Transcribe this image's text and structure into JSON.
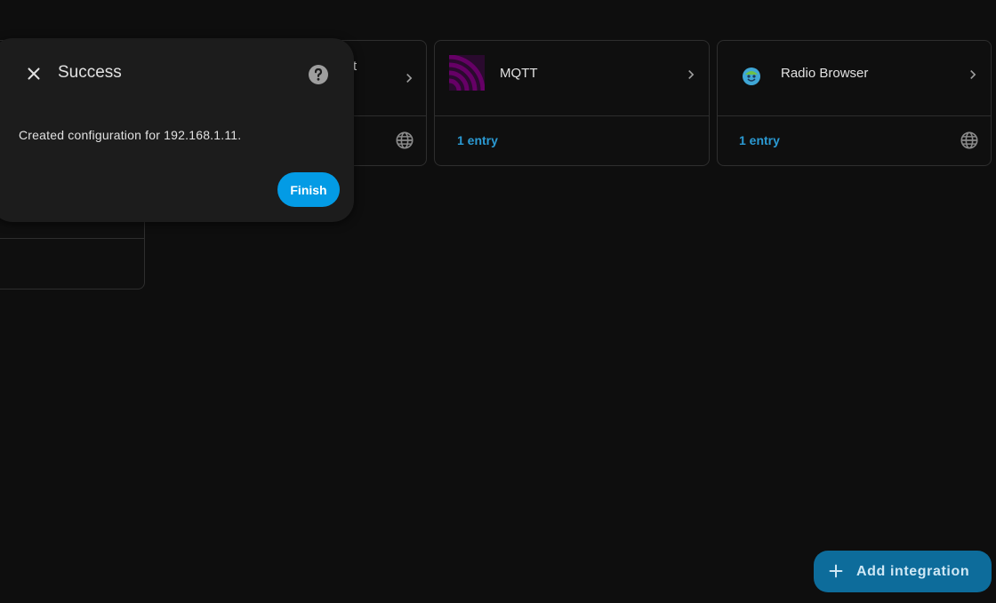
{
  "cards": {
    "partial_left": {
      "title": ""
    },
    "partial_middle": {
      "title_fragment": "t"
    },
    "mqtt": {
      "title": "MQTT",
      "entries": "1 entry"
    },
    "radio_browser": {
      "title": "Radio Browser",
      "entries": "1 entry"
    },
    "icons": {
      "chevron": "chevron-right-icon",
      "globe": "globe-icon"
    }
  },
  "dialog": {
    "title": "Success",
    "message": "Created configuration for 192.168.1.11.",
    "finish_label": "Finish",
    "close_icon": "close-icon",
    "help_icon": "help-circle-icon"
  },
  "fab": {
    "label": "Add integration",
    "icon": "plus-icon"
  },
  "colors": {
    "background": "#0e0e0e",
    "card_border": "#2e2e2e",
    "accent": "#039be5",
    "link": "#2b9ad3",
    "fab": "#0d6c9b"
  }
}
